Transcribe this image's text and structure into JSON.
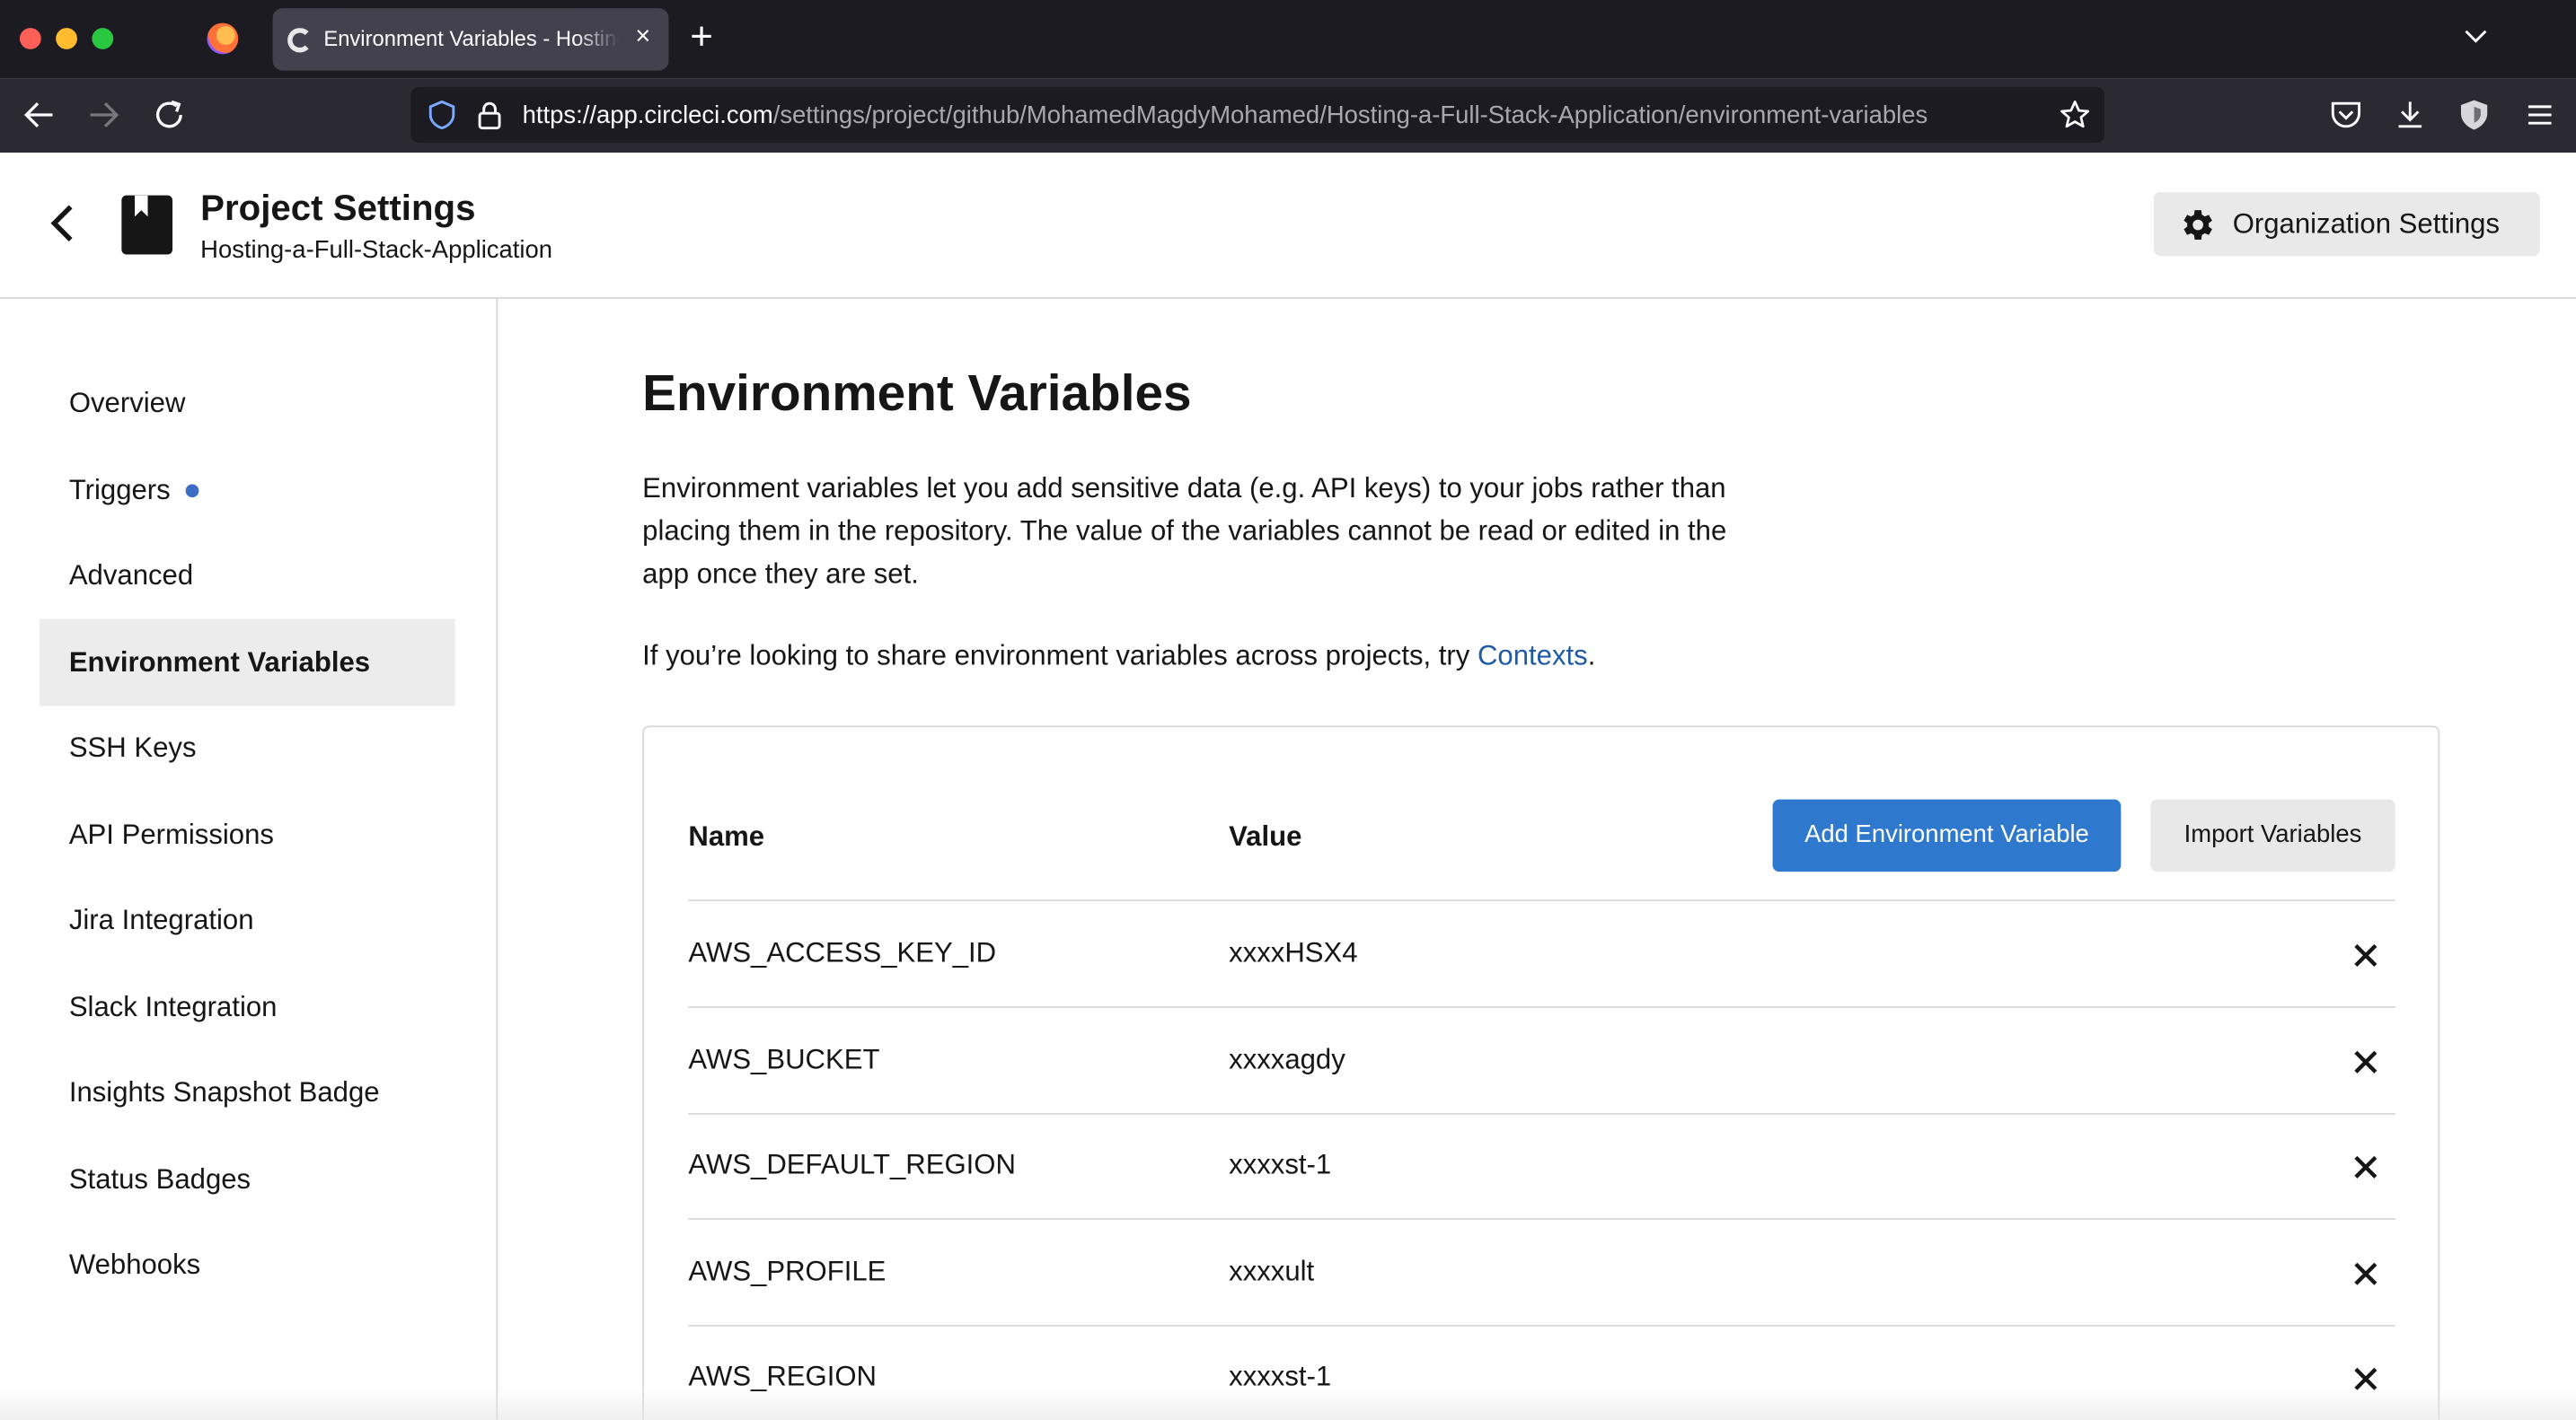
{
  "browser": {
    "tab_title": "Environment Variables - Hosting-a-Full-Stack-Application",
    "tab_close": "×",
    "new_tab": "+",
    "url_host": "https://app.circleci.com",
    "url_path": "/settings/project/github/MohamedMagdyMohamed/Hosting-a-Full-Stack-Application/environment-variables"
  },
  "header": {
    "title": "Project Settings",
    "project_name": "Hosting-a-Full-Stack-Application",
    "org_settings_label": "Organization Settings"
  },
  "sidebar": {
    "items": [
      {
        "label": "Overview"
      },
      {
        "label": "Triggers",
        "badge": "dot"
      },
      {
        "label": "Advanced"
      },
      {
        "label": "Environment Variables",
        "active": true
      },
      {
        "label": "SSH Keys"
      },
      {
        "label": "API Permissions"
      },
      {
        "label": "Jira Integration"
      },
      {
        "label": "Slack Integration"
      },
      {
        "label": "Insights Snapshot Badge"
      },
      {
        "label": "Status Badges"
      },
      {
        "label": "Webhooks"
      }
    ]
  },
  "main": {
    "title": "Environment Variables",
    "description": "Environment variables let you add sensitive data (e.g. API keys) to your jobs rather than placing them in the repository. The value of the variables cannot be read or edited in the app once they are set.",
    "share_prefix": "If you’re looking to share environment variables across projects, try ",
    "share_link": "Contexts",
    "share_suffix": ".",
    "table": {
      "col_name": "Name",
      "col_value": "Value",
      "add_button": "Add Environment Variable",
      "import_button": "Import Variables",
      "rows": [
        {
          "name": "AWS_ACCESS_KEY_ID",
          "value": "xxxxHSX4"
        },
        {
          "name": "AWS_BUCKET",
          "value": "xxxxagdy"
        },
        {
          "name": "AWS_DEFAULT_REGION",
          "value": "xxxxst-1"
        },
        {
          "name": "AWS_PROFILE",
          "value": "xxxxult"
        },
        {
          "name": "AWS_REGION",
          "value": "xxxxst-1"
        }
      ]
    }
  },
  "colors": {
    "primary_button": "#2e79ce",
    "link": "#1f5aa6",
    "triggers_dot": "#3b6ec3"
  }
}
